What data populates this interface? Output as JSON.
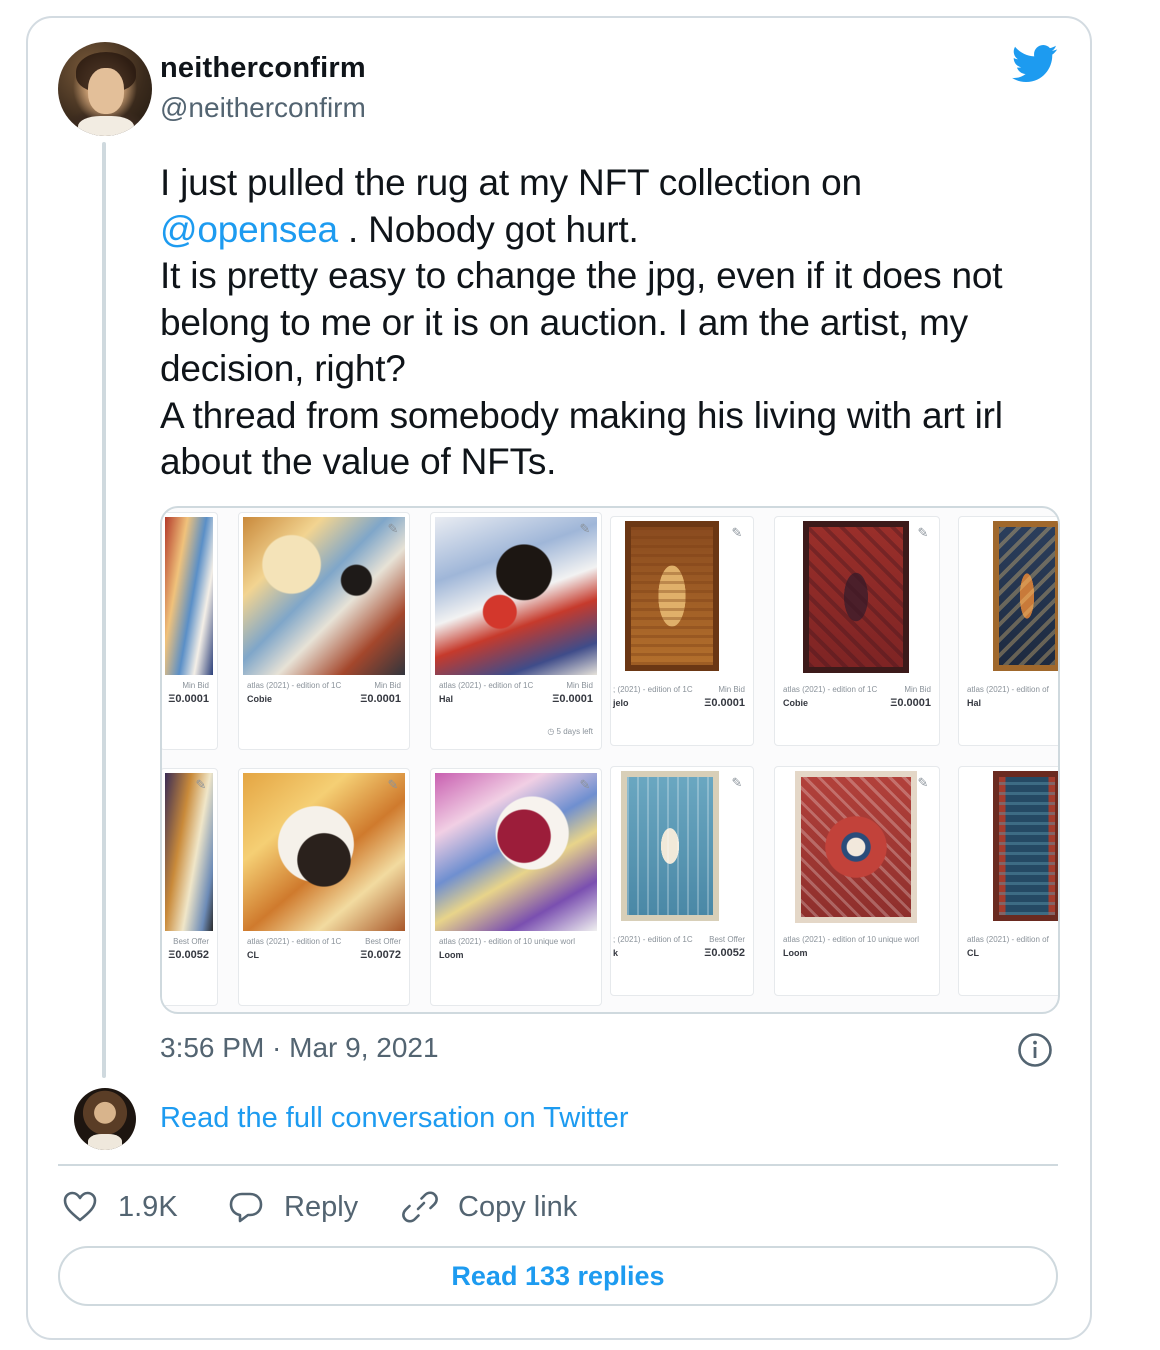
{
  "author": {
    "display_name": "neitherconfirm",
    "handle": "@neitherconfirm"
  },
  "tweet": {
    "line1": "I just pulled the rug at my NFT collection on",
    "mention": "@opensea",
    "line2_rest": " . Nobody got hurt.",
    "line3": "It is pretty easy to change the jpg, even if it does not",
    "line4": "belong to me or it is on auction. I am the artist, my",
    "line5": "decision, right?",
    "line6": "A thread from somebody making his living with art irl",
    "line7": "about the value of NFTs."
  },
  "media": {
    "tiles_top": [
      {
        "meta": "",
        "price_label": "Min Bid",
        "creator": "",
        "price": "Ξ0.0001"
      },
      {
        "meta": "atlas (2021) - edition of 1C",
        "price_label": "Min Bid",
        "creator": "Cobie",
        "price": "Ξ0.0001"
      },
      {
        "meta": "atlas (2021) - edition of 1C",
        "price_label": "Min Bid",
        "creator": "Hal",
        "price": "Ξ0.0001",
        "days": "5 days left"
      },
      {
        "meta": "; (2021) - edition of 1C",
        "price_label": "Min Bid",
        "creator": "jelo",
        "price": "Ξ0.0001"
      },
      {
        "meta": "atlas (2021) - edition of 1C",
        "price_label": "Min Bid",
        "creator": "Cobie",
        "price": "Ξ0.0001"
      },
      {
        "meta": "atlas (2021) - edition of",
        "price_label": "",
        "creator": "Hal",
        "price": ""
      }
    ],
    "tiles_bottom": [
      {
        "meta": "",
        "price_label": "Best Offer",
        "creator": "",
        "price": "Ξ0.0052"
      },
      {
        "meta": "atlas (2021) - edition of 1C",
        "price_label": "Best Offer",
        "creator": "CL",
        "price": "Ξ0.0072"
      },
      {
        "meta": "atlas (2021) - edition of 10 unique worl",
        "price_label": "",
        "creator": "Loom",
        "price": ""
      },
      {
        "meta": "; (2021) - edition of 1C",
        "price_label": "Best Offer",
        "creator": "k",
        "price": "Ξ0.0052"
      },
      {
        "meta": "atlas (2021) - edition of 10 unique worl",
        "price_label": "",
        "creator": "Loom",
        "price": ""
      },
      {
        "meta": "atlas (2021) - edition of",
        "price_label": "",
        "creator": "CL",
        "price": ""
      }
    ]
  },
  "timestamp": "3:56 PM · Mar 9, 2021",
  "read_conversation": "Read the full conversation on Twitter",
  "actions": {
    "like_count": "1.9K",
    "reply_label": "Reply",
    "copy_label": "Copy link"
  },
  "read_replies": "Read 133 replies",
  "colors": {
    "accent": "#1d9bf0",
    "text": "#0f1419",
    "muted": "#536471",
    "border": "#cfd9de"
  },
  "icons": [
    "twitter-bird-icon",
    "info-icon",
    "heart-icon",
    "reply-bubble-icon",
    "link-icon",
    "pencil-icon",
    "clock-icon"
  ]
}
